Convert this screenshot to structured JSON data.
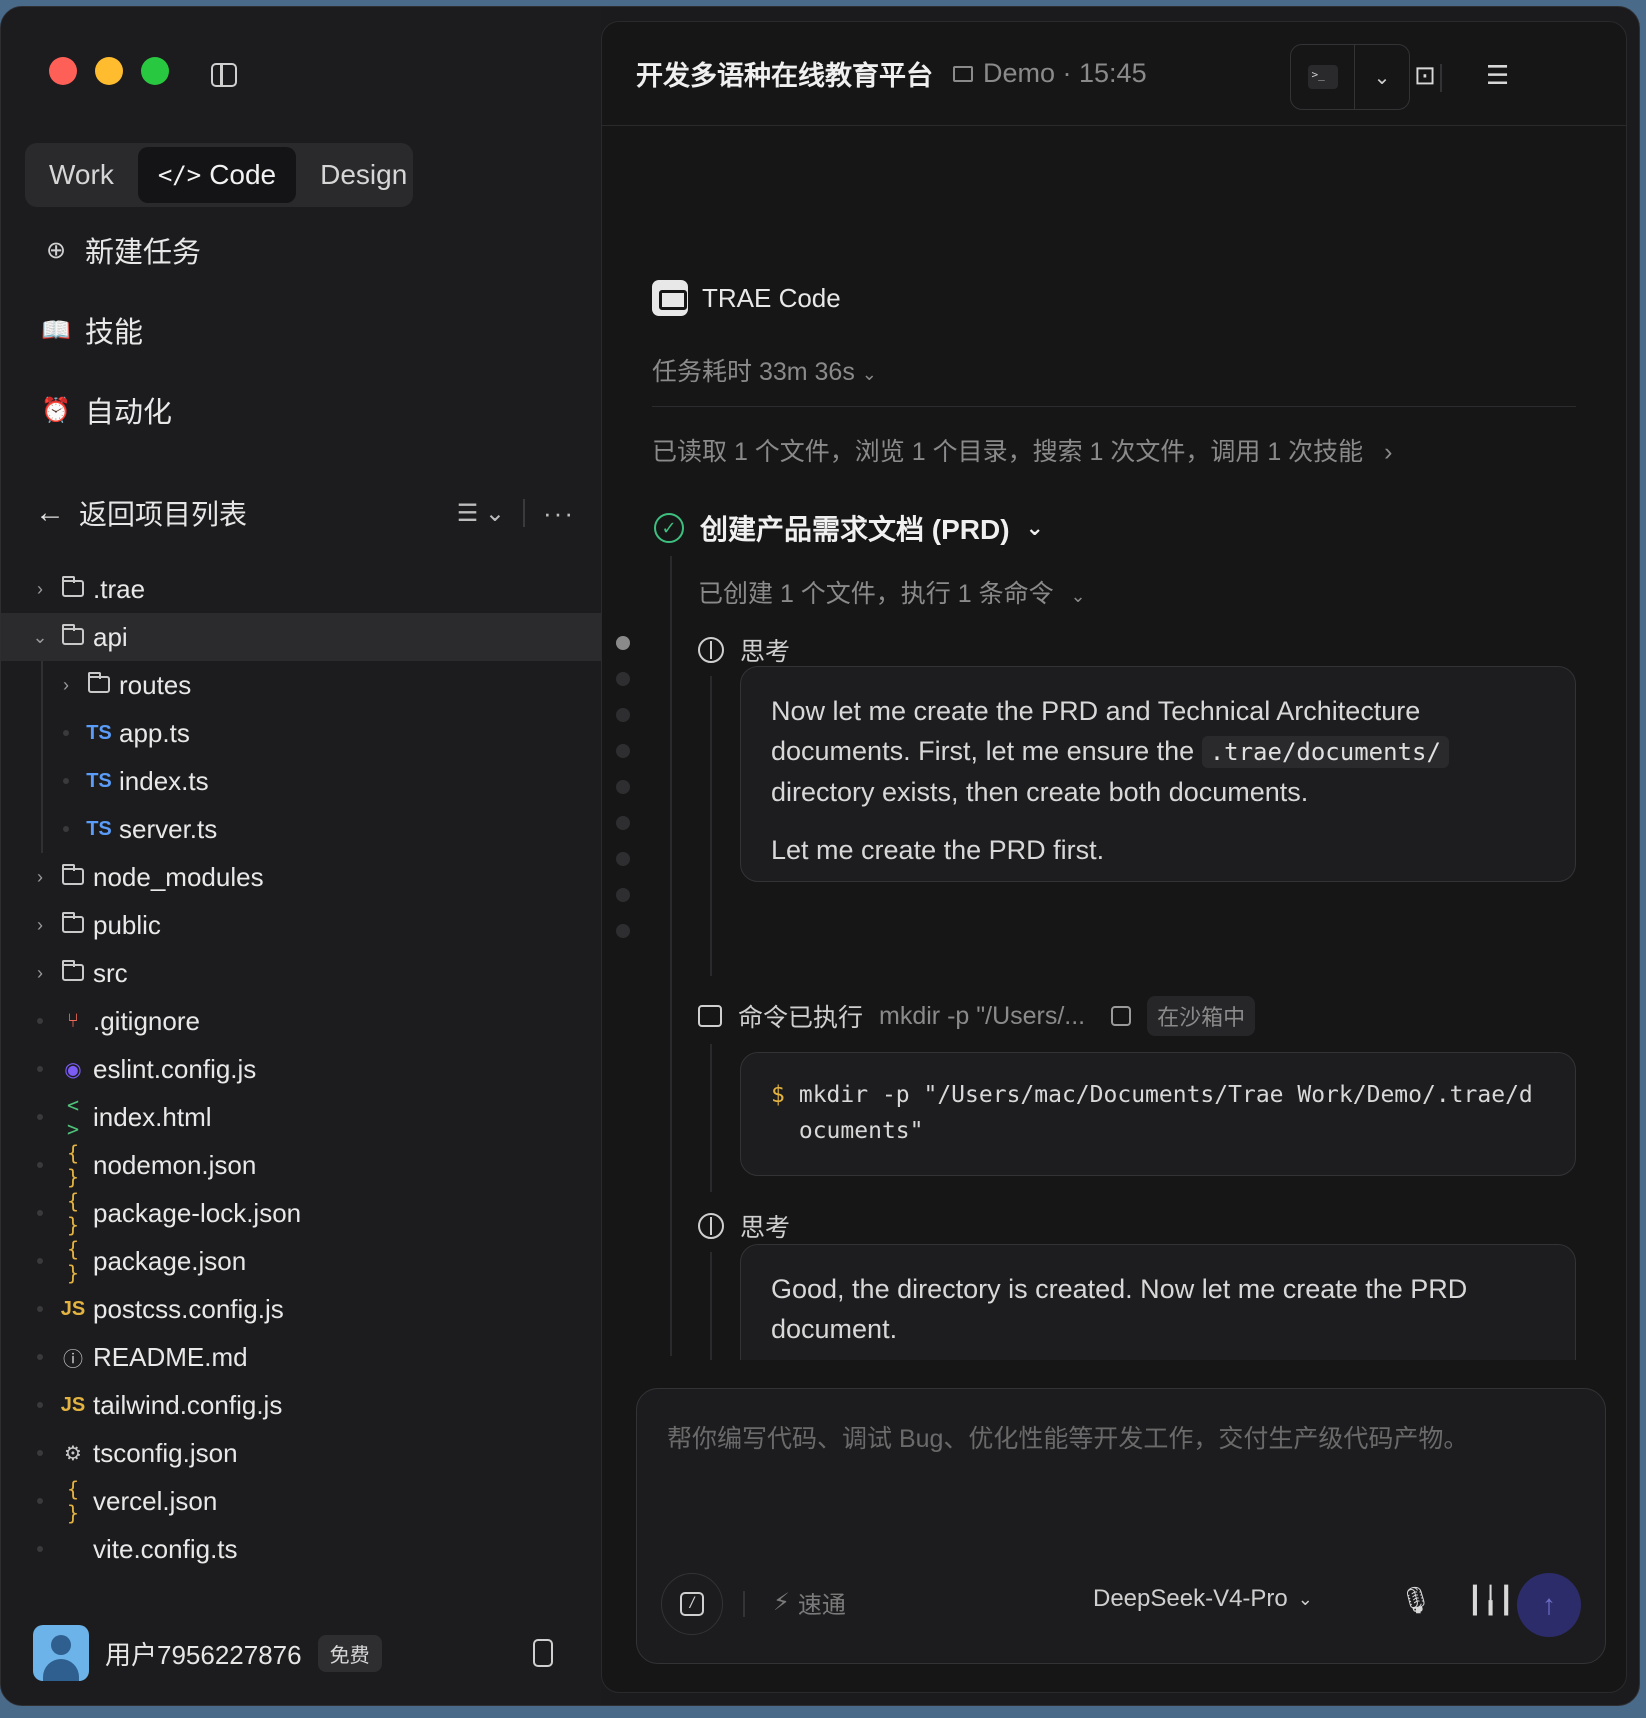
{
  "sidebar": {
    "modes": [
      {
        "label": "Work"
      },
      {
        "label": "Code",
        "icon": "code-icon"
      },
      {
        "label": "Design"
      }
    ],
    "nav": [
      {
        "label": "新建任务",
        "icon": "new-task-icon"
      },
      {
        "label": "技能",
        "icon": "book-icon"
      },
      {
        "label": "自动化",
        "icon": "alarm-icon"
      }
    ],
    "back_label": "返回项目列表",
    "files": [
      {
        "name": ".trae",
        "type": "folder",
        "expanded": false,
        "depth": 0
      },
      {
        "name": "api",
        "type": "folder",
        "expanded": true,
        "depth": 0,
        "selected": true
      },
      {
        "name": "routes",
        "type": "folder",
        "expanded": false,
        "depth": 1
      },
      {
        "name": "app.ts",
        "type": "ts",
        "icon_text": "TS",
        "depth": 1
      },
      {
        "name": "index.ts",
        "type": "ts",
        "icon_text": "TS",
        "depth": 1
      },
      {
        "name": "server.ts",
        "type": "ts",
        "icon_text": "TS",
        "depth": 1
      },
      {
        "name": "node_modules",
        "type": "folder",
        "expanded": false,
        "depth": 0
      },
      {
        "name": "public",
        "type": "folder",
        "expanded": false,
        "depth": 0
      },
      {
        "name": "src",
        "type": "folder",
        "expanded": false,
        "depth": 0
      },
      {
        "name": ".gitignore",
        "type": "git",
        "depth": 0
      },
      {
        "name": "eslint.config.js",
        "type": "eslint",
        "depth": 0
      },
      {
        "name": "index.html",
        "type": "html",
        "icon_text": "< >",
        "depth": 0
      },
      {
        "name": "nodemon.json",
        "type": "json",
        "icon_text": "{ }",
        "depth": 0
      },
      {
        "name": "package-lock.json",
        "type": "json",
        "icon_text": "{ }",
        "depth": 0
      },
      {
        "name": "package.json",
        "type": "json",
        "icon_text": "{ }",
        "depth": 0
      },
      {
        "name": "postcss.config.js",
        "type": "js",
        "icon_text": "JS",
        "depth": 0
      },
      {
        "name": "README.md",
        "type": "info",
        "depth": 0
      },
      {
        "name": "tailwind.config.js",
        "type": "js",
        "icon_text": "JS",
        "depth": 0
      },
      {
        "name": "tsconfig.json",
        "type": "gear",
        "depth": 0
      },
      {
        "name": "vercel.json",
        "type": "json",
        "icon_text": "{ }",
        "depth": 0
      },
      {
        "name": "vite.config.ts",
        "type": "plain",
        "depth": 0
      }
    ],
    "user": {
      "name": "用户7956227876",
      "plan": "免费"
    }
  },
  "header": {
    "title": "开发多语种在线教育平台",
    "project": "Demo · 15:45"
  },
  "conversation": {
    "agent_name": "TRAE Code",
    "duration": "任务耗时 33m 36s",
    "summary": "已读取 1 个文件，浏览 1 个目录，搜索 1 次文件，调用 1 次技能",
    "step_title": "创建产品需求文档 (PRD)",
    "step_summary": "已创建 1 个文件，执行 1 条命令",
    "think_label": "思考",
    "think1": {
      "line1": "Now let me create the PRD and Technical Architecture documents. First, let me ensure the",
      "code": ".trae/documents/",
      "line2": "directory exists, then create both documents.",
      "line3": "Let me create the PRD first."
    },
    "command": {
      "label": "命令已执行",
      "preview": "mkdir -p \"/Users/...",
      "sandbox": "在沙箱中",
      "prompt": "$",
      "full": "mkdir -p \"/Users/mac/Documents/Trae Work/Demo/.trae/documents\""
    },
    "think2": "Good, the directory is created. Now let me create the PRD document."
  },
  "composer": {
    "placeholder": "帮你编写代码、调试 Bug、优化性能等开发工作，交付生产级代码产物。",
    "speed_label": "速通",
    "model": "DeepSeek-V4-Pro"
  },
  "colors": {
    "accent_success": "#3fbf7f",
    "ts": "#5a9cf8",
    "js": "#e3b341",
    "send_bg": "#2c2c6a"
  }
}
